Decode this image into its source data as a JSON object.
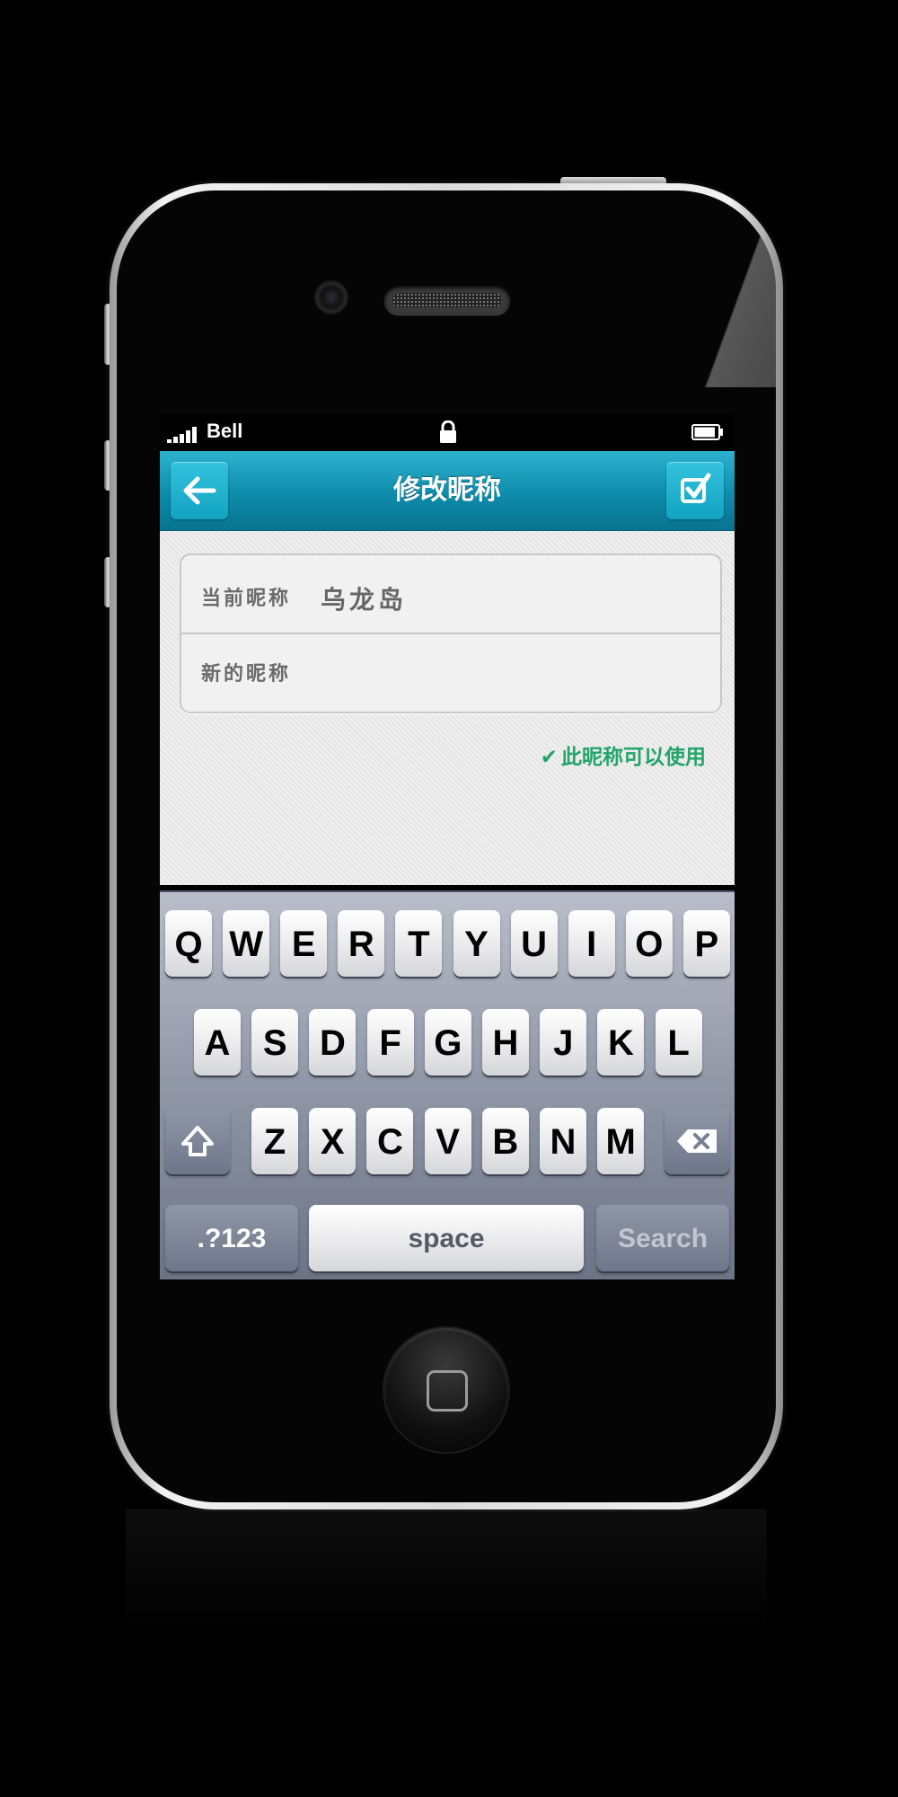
{
  "status_bar": {
    "carrier": "Bell",
    "signal_bars": 5,
    "lock_icon": "lock-icon",
    "battery_icon": "battery-icon",
    "battery_level": 0.9
  },
  "navbar": {
    "title": "修改昵称",
    "back_icon": "arrow-left-icon",
    "confirm_icon": "checkbox-check-icon",
    "color": "#1199b8"
  },
  "form": {
    "current_label": "当前昵称",
    "current_value": "乌龙岛",
    "new_label": "新的昵称",
    "new_value": "",
    "new_placeholder": ""
  },
  "hint": {
    "icon": "checkmark-icon",
    "text": "此昵称可以使用",
    "color": "#23a46a"
  },
  "keyboard": {
    "row1": [
      "Q",
      "W",
      "E",
      "R",
      "T",
      "Y",
      "U",
      "I",
      "O",
      "P"
    ],
    "row2": [
      "A",
      "S",
      "D",
      "F",
      "G",
      "H",
      "J",
      "K",
      "L"
    ],
    "row3": [
      "Z",
      "X",
      "C",
      "V",
      "B",
      "N",
      "M"
    ],
    "shift_icon": "shift-icon",
    "delete_icon": "backspace-icon",
    "numbers_label": ".?123",
    "space_label": "space",
    "search_label": "Search"
  },
  "home_button_icon": "home-square-icon"
}
